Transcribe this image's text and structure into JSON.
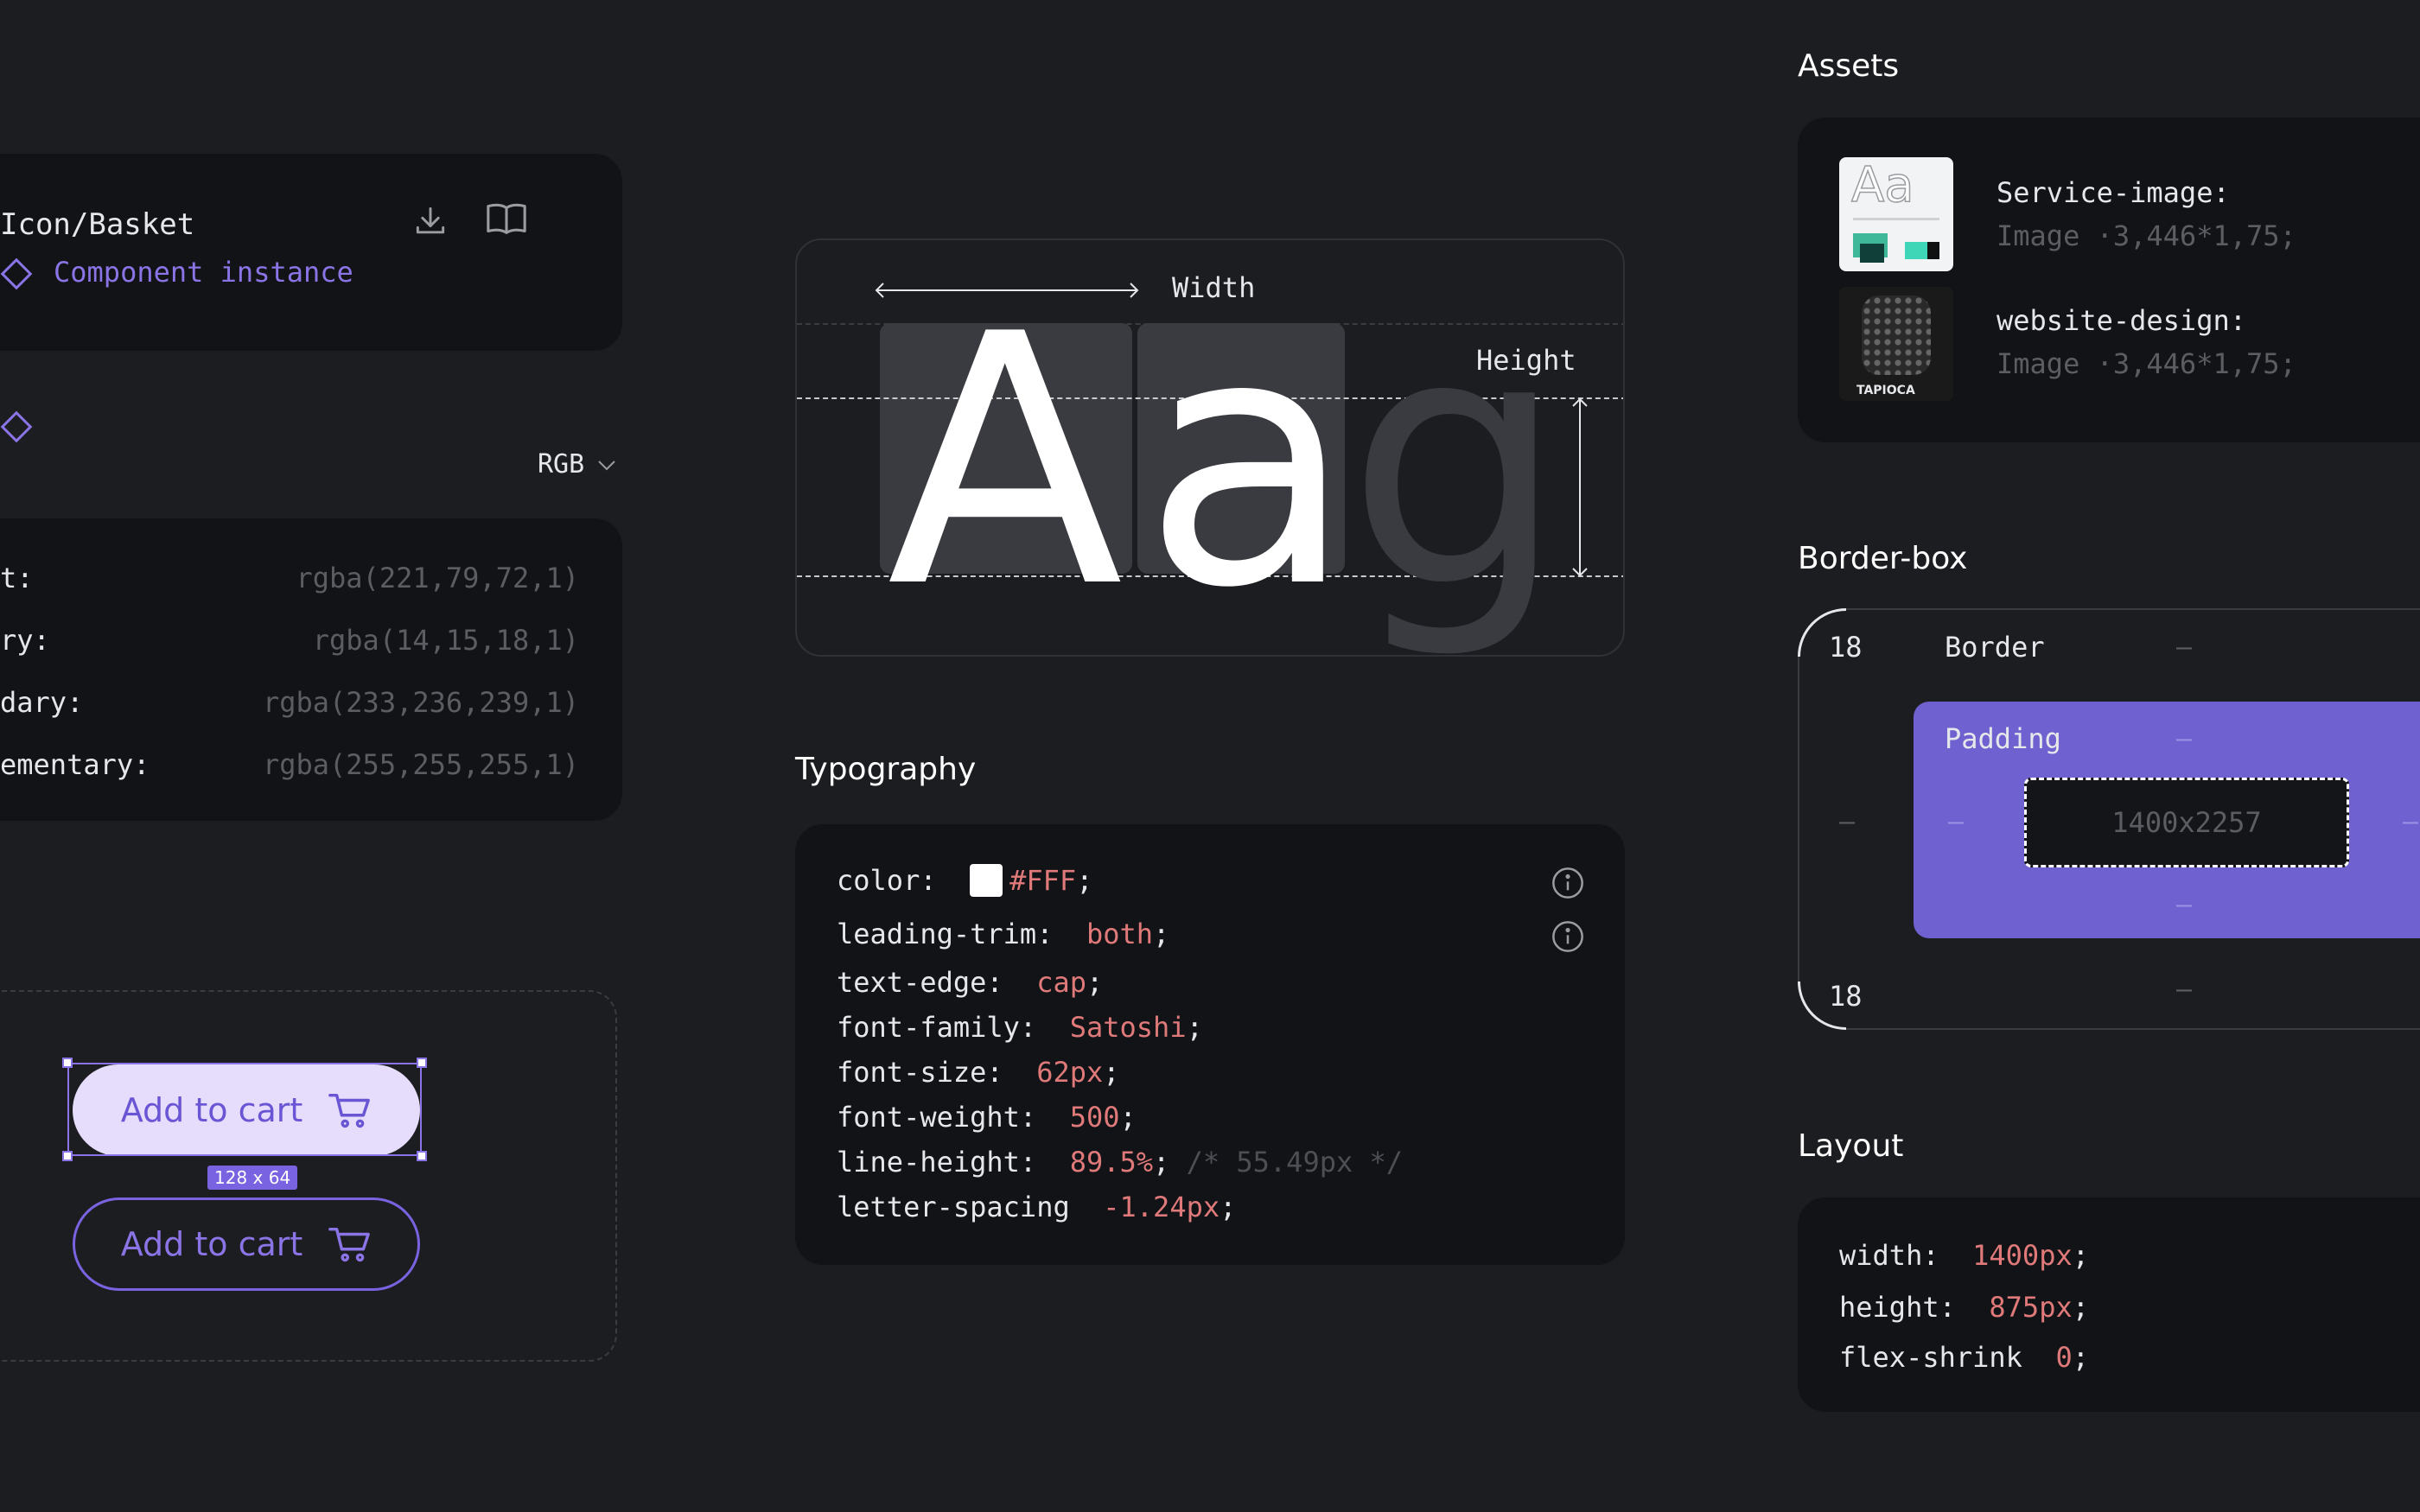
{
  "component": {
    "name": "Icon/Basket",
    "instance_label": "Component instance"
  },
  "colors": {
    "mode": "RGB",
    "rows": [
      {
        "label": "t:",
        "value": "rgba(221,79,72,1)"
      },
      {
        "label": "ry:",
        "value": "rgba(14,15,18,1)"
      },
      {
        "label": "dary:",
        "value": "rgba(233,236,239,1)"
      },
      {
        "label": "ementary:",
        "value": "rgba(255,255,255,1)"
      }
    ]
  },
  "buttons": {
    "primary_label": "Add to cart",
    "secondary_label": "Add to cart",
    "size_badge": "128 x 64"
  },
  "metrics": {
    "width_label": "Width",
    "height_label": "Height",
    "glyph_a_upper": "A",
    "glyph_a_lower": "a",
    "glyph_g": "g"
  },
  "typography": {
    "title": "Typography",
    "rows": [
      {
        "prop": "color:",
        "value": "#FFF",
        "suffix": ";"
      },
      {
        "prop": "leading-trim:",
        "value": "both",
        "suffix": ";"
      },
      {
        "prop": "text-edge:",
        "value": "cap",
        "suffix": ";"
      },
      {
        "prop": "font-family:",
        "value": "Satoshi",
        "suffix": ";"
      },
      {
        "prop": "font-size:",
        "value": "62px",
        "suffix": ";"
      },
      {
        "prop": "font-weight:",
        "value": "500",
        "suffix": ";"
      },
      {
        "prop": "line-height:",
        "value": "89.5%",
        "suffix": ";",
        "comment": "/* 55.49px */"
      },
      {
        "prop": "letter-spacing",
        "value": "-1.24px",
        "suffix": ";"
      }
    ]
  },
  "assets": {
    "title": "Assets",
    "items": [
      {
        "name": "Service-image:",
        "meta": "Image ·3,446*1,75;",
        "thumb_text": "Aa"
      },
      {
        "name": "website-design:",
        "meta": "Image ·3,446*1,75;",
        "thumb_text": "TAPIOCA"
      }
    ]
  },
  "border_box": {
    "title": "Border-box",
    "top_value": "18",
    "bottom_value": "18",
    "border_label": "Border",
    "padding_label": "Padding",
    "content_size": "1400x2257",
    "dash": "–"
  },
  "layout": {
    "title": "Layout",
    "rows": [
      {
        "prop": "width:",
        "value": "1400px",
        "suffix": ";"
      },
      {
        "prop": "height:",
        "value": "875px",
        "suffix": ";"
      },
      {
        "prop": "flex-shrink",
        "value": "0",
        "suffix": ";"
      }
    ]
  },
  "accent_color": "#7a63e0",
  "value_color": "#e07a7a"
}
